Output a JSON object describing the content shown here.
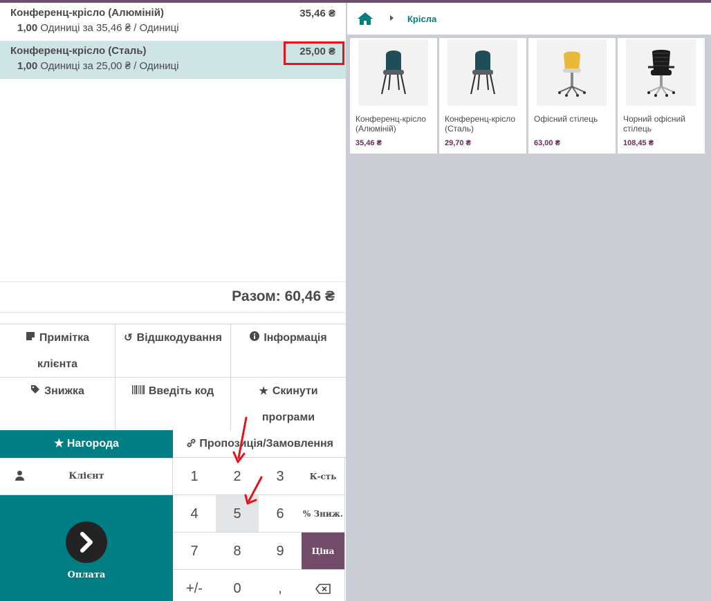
{
  "order": {
    "lines": [
      {
        "name": "Конференц-крісло (Алюміній)",
        "price": "35,46 ₴",
        "qty": "1,00",
        "detail": "Одиниці за 35,46 ₴ / Одиниці"
      },
      {
        "name": "Конференц-крісло (Сталь)",
        "price": "25,00 ₴",
        "qty": "1,00",
        "detail": "Одиниці за 25,00 ₴ / Одиниці"
      }
    ],
    "total": "Разом: 60,46 ₴"
  },
  "controls": {
    "note_line1": "Примітка",
    "note_line2": "клієнта",
    "refund": "Відшкодування",
    "info": "Інформація",
    "discount": "Знижка",
    "code": "Введіть код",
    "reset_line1": "Скинути",
    "reset_line2": "програми"
  },
  "actions": {
    "reward": "Нагорода",
    "proposal": "Пропозиція/Замовлення",
    "client": "Клієнт",
    "pay": "Оплата"
  },
  "numpad": {
    "k1": "1",
    "k2": "2",
    "k3": "3",
    "qty": "К-сть",
    "k4": "4",
    "k5": "5",
    "k6": "6",
    "disc": "% Зниж.",
    "k7": "7",
    "k8": "8",
    "k9": "9",
    "price": "Ціна",
    "sign": "+/-",
    "k0": "0",
    "dec": ","
  },
  "breadcrumb": {
    "category": "Крісла"
  },
  "products": [
    {
      "name": "Конференц-крісло (Алюміній)",
      "price": "35,46 ₴"
    },
    {
      "name": "Конференц-крісло (Сталь)",
      "price": "29,70 ₴"
    },
    {
      "name": "Офісний стілець",
      "price": "63,00 ₴"
    },
    {
      "name": "Чорний офісний стілець",
      "price": "108,45 ₴"
    }
  ],
  "colors": {
    "accent": "#017e84",
    "brand": "#714b67",
    "highlight": "#e0151b"
  }
}
